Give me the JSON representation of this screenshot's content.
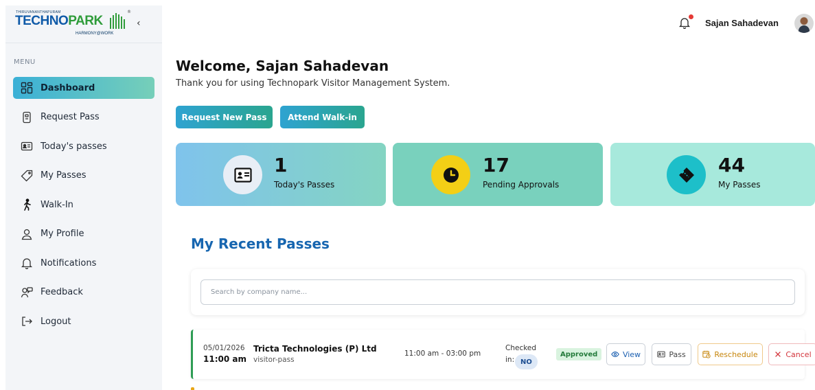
{
  "brand": {
    "top": "THIRUVANANTHAPURAM",
    "name_part1": "TECHNO",
    "name_part2": "PARK",
    "tagline": "HARMONY@WORK",
    "reg": "®",
    "collapse": "‹"
  },
  "sidebar": {
    "menu_label": "MENU",
    "items": [
      {
        "label": "Dashboard",
        "icon": "dashboard-icon"
      },
      {
        "label": "Request Pass",
        "icon": "request-pass-icon"
      },
      {
        "label": "Today's passes",
        "icon": "id-card-icon"
      },
      {
        "label": "My Passes",
        "icon": "tag-icon"
      },
      {
        "label": "Walk-In",
        "icon": "walking-icon"
      },
      {
        "label": "My Profile",
        "icon": "user-icon"
      },
      {
        "label": "Notifications",
        "icon": "bell-icon"
      },
      {
        "label": "Feedback",
        "icon": "feedback-icon"
      },
      {
        "label": "Logout",
        "icon": "logout-icon"
      }
    ]
  },
  "header": {
    "user_name": "Sajan Sahadevan"
  },
  "welcome": {
    "title": "Welcome, Sajan Sahadevan",
    "subtitle": "Thank you for using Technopark Visitor Management System."
  },
  "actions": {
    "request_new_pass": "Request New Pass",
    "attend_walkin": "Attend Walk-in"
  },
  "stats": [
    {
      "value": "1",
      "label": "Today's Passes"
    },
    {
      "value": "17",
      "label": "Pending Approvals"
    },
    {
      "value": "44",
      "label": "My Passes"
    }
  ],
  "recent": {
    "title": "My Recent Passes",
    "search_placeholder": "Search by company name...",
    "rows": [
      {
        "date": "05/01/2026",
        "time": "11:00 am",
        "company": "Tricta Technologies (P) Ltd",
        "type": "visitor-pass",
        "slot": "11:00 am - 03:00 pm",
        "checked_label": "Checked",
        "checked_in_label": "in:",
        "checked_value": "NO",
        "status": "Approved",
        "buttons": {
          "view": "View",
          "pass": "Pass",
          "reschedule": "Reschedule",
          "cancel": "Cancel"
        }
      }
    ]
  },
  "colors": {
    "accent_blue": "#1766b0",
    "approved_green": "#2e9d55",
    "pending_yellow": "#f3cf16"
  }
}
